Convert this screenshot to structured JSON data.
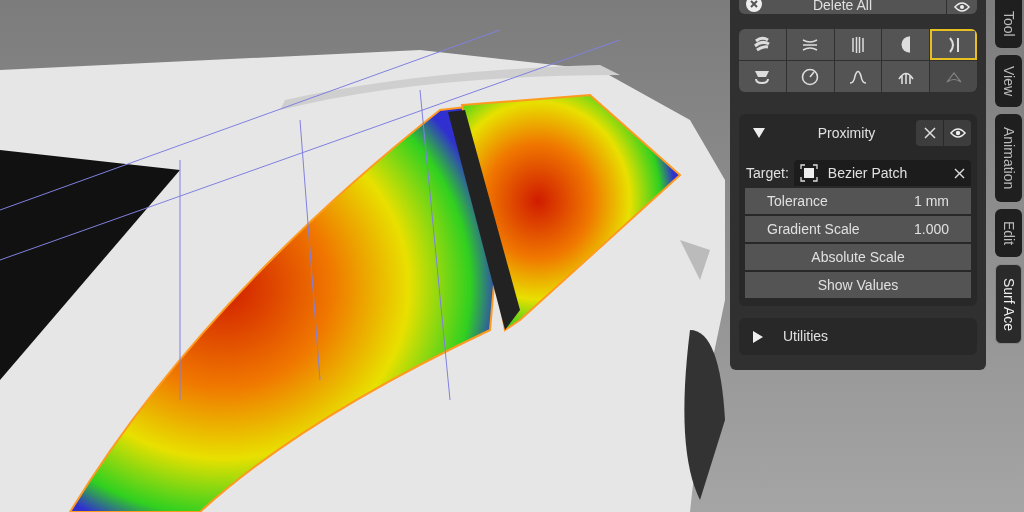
{
  "panel": {
    "delete_button": {
      "label": "Delete All"
    },
    "tools": [
      {
        "selected": false,
        "disabled": false
      },
      {
        "selected": false,
        "disabled": false
      },
      {
        "selected": false,
        "disabled": false
      },
      {
        "selected": false,
        "disabled": false
      },
      {
        "selected": true,
        "disabled": false
      },
      {
        "selected": false,
        "disabled": false
      },
      {
        "selected": false,
        "disabled": false
      },
      {
        "selected": false,
        "disabled": false
      },
      {
        "selected": false,
        "disabled": false
      },
      {
        "selected": false,
        "disabled": true
      }
    ],
    "proximity": {
      "title": "Proximity",
      "expanded": true,
      "target_label": "Target:",
      "target_value": "Bezier Patch",
      "fields": [
        {
          "kind": "value",
          "label": "Tolerance",
          "value": "1 mm"
        },
        {
          "kind": "value",
          "label": "Gradient Scale",
          "value": "1.000"
        },
        {
          "kind": "toggle",
          "label": "Absolute Scale"
        },
        {
          "kind": "toggle",
          "label": "Show Values"
        }
      ]
    },
    "utilities": {
      "title": "Utilities",
      "expanded": false
    }
  },
  "side_tabs": [
    {
      "label": "Tool",
      "selected": false
    },
    {
      "label": "View",
      "selected": false
    },
    {
      "label": "Animation",
      "selected": false
    },
    {
      "label": "Edit",
      "selected": false
    },
    {
      "label": "Surf Ace",
      "selected": true
    }
  ]
}
